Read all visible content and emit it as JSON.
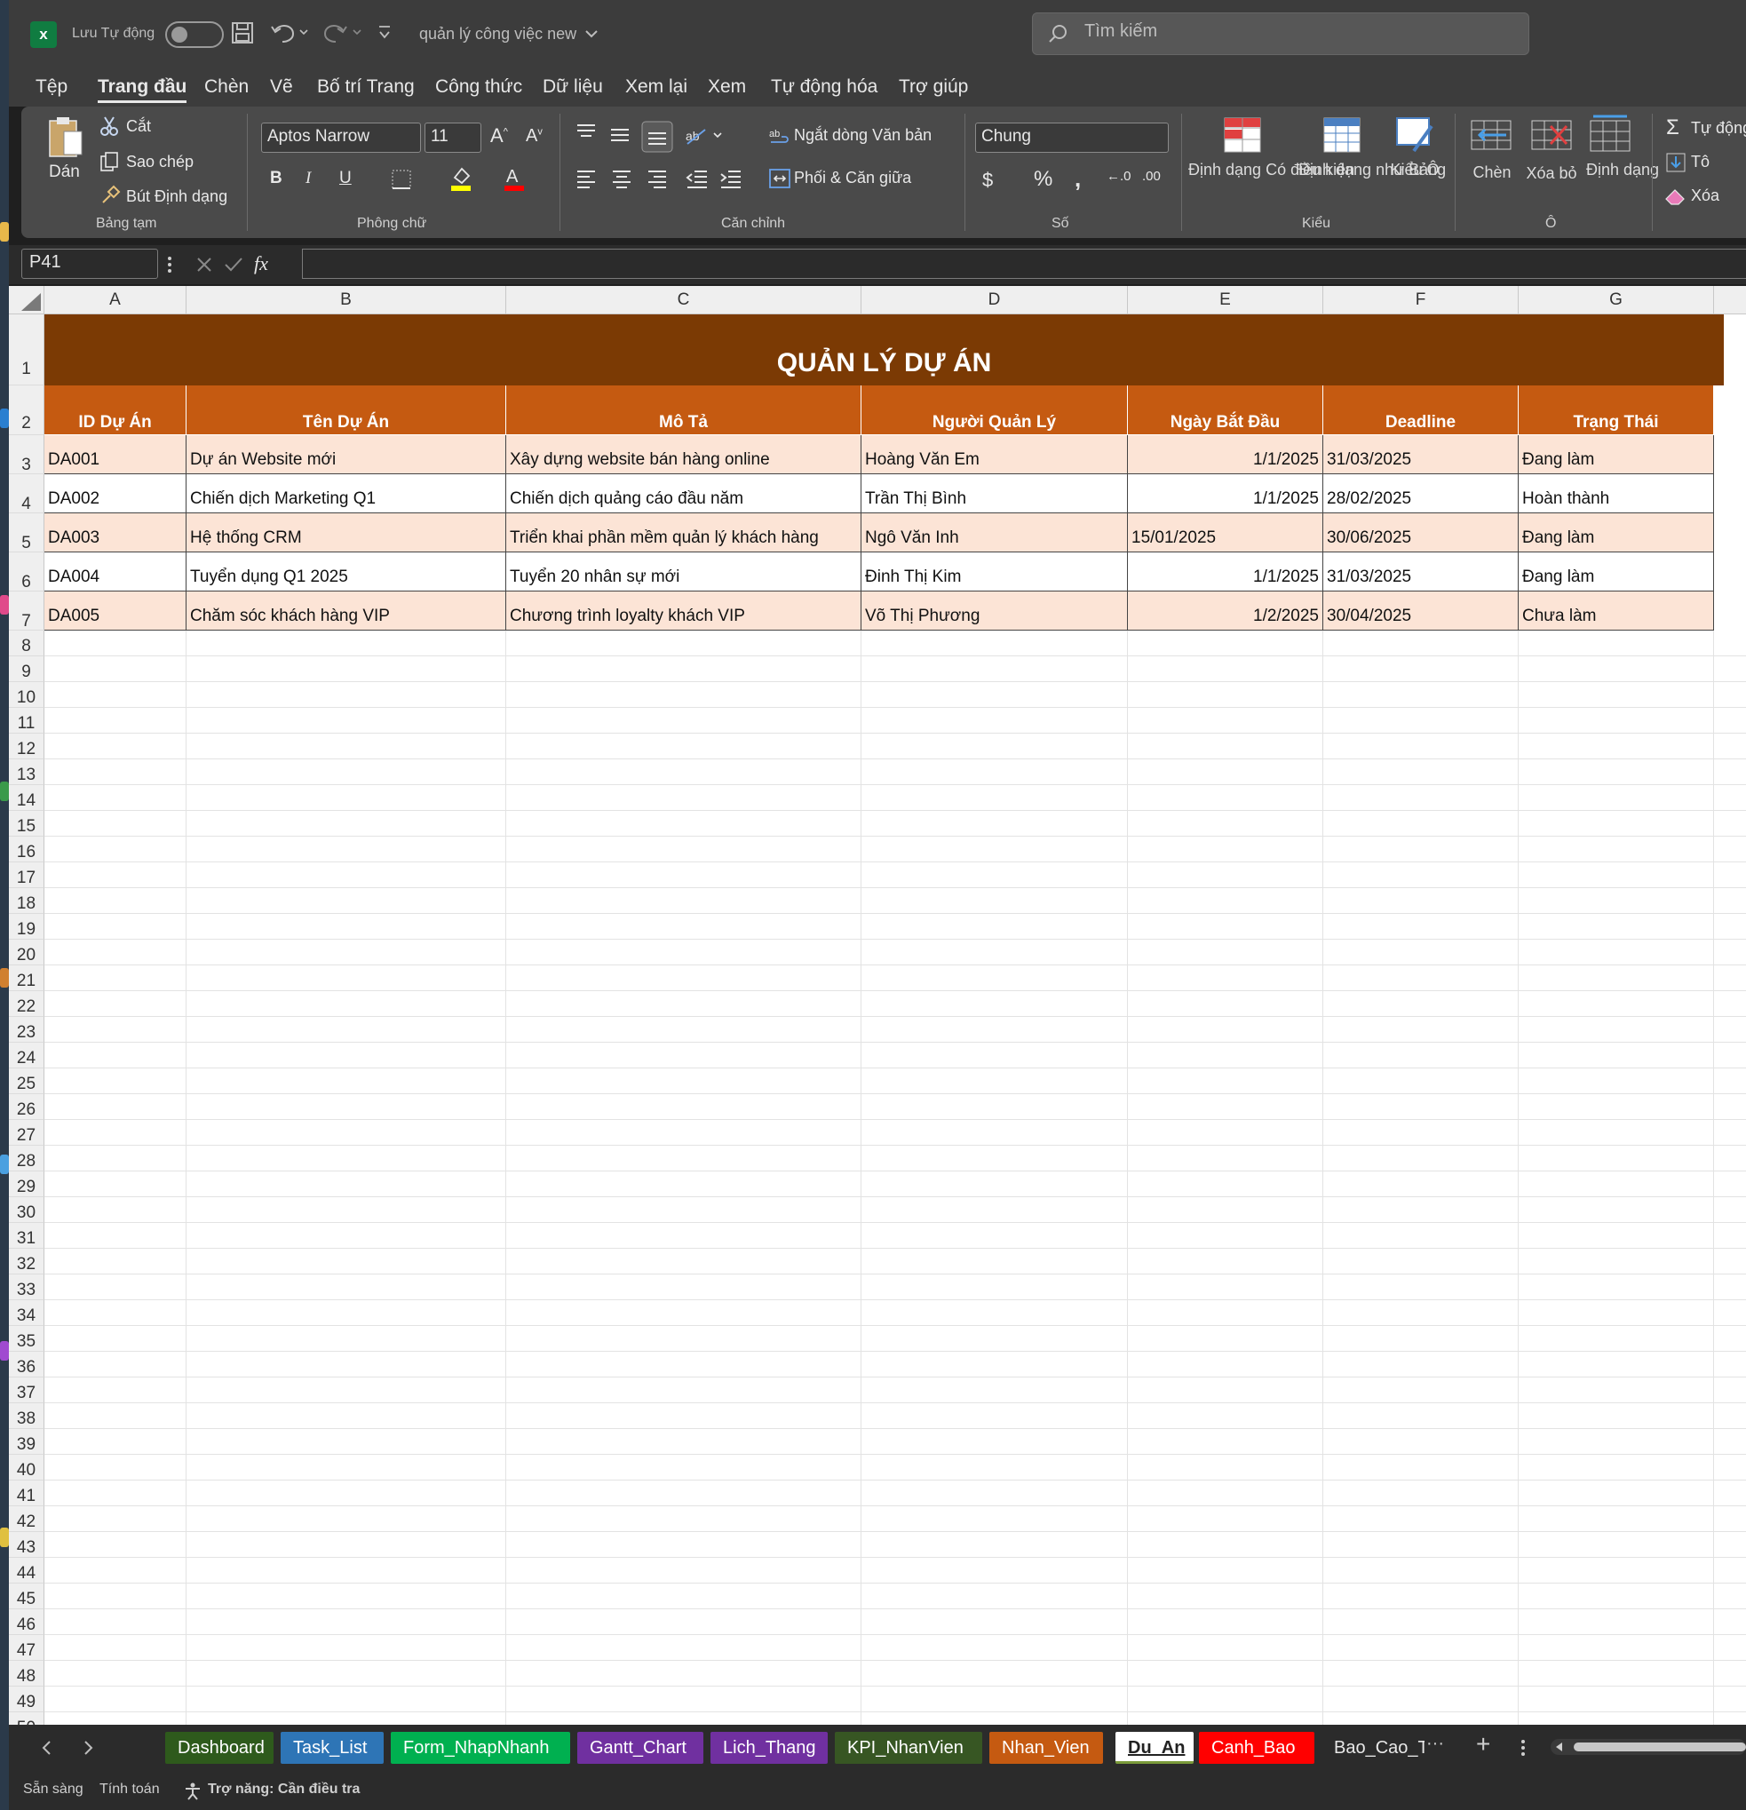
{
  "titlebar": {
    "autosave_label": "Lưu Tự động",
    "doc_title": "quản lý công việc new",
    "search_placeholder": "Tìm kiếm"
  },
  "menu": [
    "Tệp",
    "Trang đầu",
    "Chèn",
    "Vẽ",
    "Bố trí Trang",
    "Công thức",
    "Dữ liệu",
    "Xem lại",
    "Xem",
    "Tự động hóa",
    "Trợ giúp"
  ],
  "ribbon": {
    "clipboard": {
      "paste": "Dán",
      "cut": "Cắt",
      "copy": "Sao chép",
      "format_painter": "Bút Định dạng",
      "label": "Bảng tạm"
    },
    "font": {
      "name": "Aptos Narrow",
      "size": "11",
      "label": "Phông chữ"
    },
    "alignment": {
      "wrap": "Ngắt dòng Văn bản",
      "merge": "Phối & Căn giữa",
      "label": "Căn chỉnh"
    },
    "number": {
      "format": "Chung",
      "label": "Số"
    },
    "styles": {
      "conditional": "Định dạng Có điều kiện",
      "as_table": "Định dạng như Bảng",
      "cell_styles": "Kiểu Ô",
      "label": "Kiểu"
    },
    "cells": {
      "insert": "Chèn",
      "delete": "Xóa bỏ",
      "format": "Định dạng",
      "label": "Ô"
    },
    "editing": {
      "autosum": "Tự động",
      "fill": "Tô",
      "clear": "Xóa"
    }
  },
  "formula_bar": {
    "name_box": "P41",
    "formula": ""
  },
  "columns": [
    "A",
    "B",
    "C",
    "D",
    "E",
    "F",
    "G"
  ],
  "sheet": {
    "title": "QUẢN LÝ DỰ ÁN",
    "headers": [
      "ID Dự Án",
      "Tên Dự Án",
      "Mô Tả",
      "Người Quản Lý",
      "Ngày Bắt Đầu",
      "Deadline",
      "Trạng Thái"
    ],
    "rows": [
      [
        "DA001",
        "Dự án Website mới",
        "Xây dựng website bán hàng online",
        "Hoàng Văn Em",
        "1/1/2025",
        "31/03/2025",
        "Đang làm"
      ],
      [
        "DA002",
        "Chiến dịch Marketing Q1",
        "Chiến dịch quảng cáo đầu năm",
        "Trần Thị Bình",
        "1/1/2025",
        "28/02/2025",
        "Hoàn thành"
      ],
      [
        "DA003",
        "Hệ thống CRM",
        "Triển khai phần mềm quản lý khách hàng",
        "Ngô Văn Inh",
        "15/01/2025",
        "30/06/2025",
        "Đang làm"
      ],
      [
        "DA004",
        "Tuyển dụng Q1 2025",
        "Tuyển 20 nhân sự mới",
        "Đinh Thị Kim",
        "1/1/2025",
        "31/03/2025",
        "Đang làm"
      ],
      [
        "DA005",
        "Chăm sóc khách hàng VIP",
        "Chương trình loyalty khách VIP",
        "Võ Thị Phương",
        "1/2/2025",
        "30/04/2025",
        "Chưa làm"
      ]
    ],
    "colors": {
      "title_bg": "#7b3a04",
      "header_bg": "#c55a11",
      "band_bg": "#fce4d6"
    }
  },
  "tabs": [
    {
      "label": "Dashboard",
      "color": "#2e5a1c"
    },
    {
      "label": "Task_List",
      "color": "#2e75b6"
    },
    {
      "label": "Form_NhapNhanh",
      "color": "#00b050"
    },
    {
      "label": "Gantt_Chart",
      "color": "#7030a0"
    },
    {
      "label": "Lich_Thang",
      "color": "#7030a0"
    },
    {
      "label": "KPI_NhanVien",
      "color": "#375623"
    },
    {
      "label": "Nhan_Vien",
      "color": "#c55a11"
    },
    {
      "label": "Du_An",
      "color": "#ffffff",
      "active": true
    },
    {
      "label": "Canh_Bao",
      "color": "#ff0000"
    },
    {
      "label": "Bao_Cao_T",
      "color": ""
    }
  ],
  "status": {
    "ready": "Sẵn sàng",
    "calc": "Tính toán",
    "accessibility": "Trợ năng: Cần điều tra"
  }
}
